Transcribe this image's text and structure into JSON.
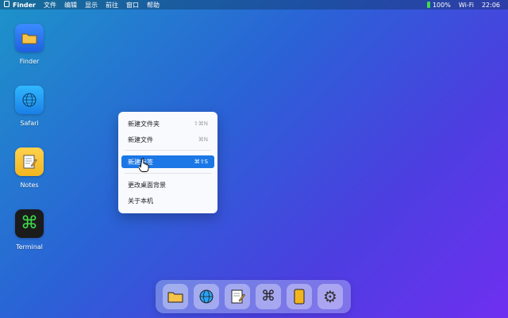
{
  "menubar": {
    "apple_icon": "apple-logo-icon",
    "app_name": "Finder",
    "items": [
      "文件",
      "编辑",
      "显示",
      "前往",
      "窗口",
      "帮助"
    ],
    "battery": "100%",
    "wifi": "Wi-Fi",
    "clock": "22:06"
  },
  "desktop": {
    "icons": [
      {
        "label": "Finder",
        "icon": "folder-icon"
      },
      {
        "label": "Safari",
        "icon": "globe-icon"
      },
      {
        "label": "Notes",
        "icon": "notepad-icon"
      },
      {
        "label": "Terminal",
        "icon": "command-icon"
      }
    ]
  },
  "context_menu": {
    "items": [
      {
        "label": "新建文件夹",
        "shortcut": "⇧⌘N"
      },
      {
        "label": "新建文件",
        "shortcut": "⌘N"
      },
      {
        "label": "新建标签",
        "shortcut": "⌘⇧S",
        "highlighted": true
      },
      {
        "label": "更改桌面背景",
        "shortcut": ""
      },
      {
        "label": "关于本机",
        "shortcut": ""
      }
    ]
  },
  "dock": {
    "items": [
      "folder-icon",
      "globe-icon",
      "notepad-icon",
      "command-icon",
      "phone-icon",
      "gear-icon"
    ]
  },
  "colors": {
    "highlight": "#1b77e6",
    "terminal_green": "#3ddc4a"
  }
}
